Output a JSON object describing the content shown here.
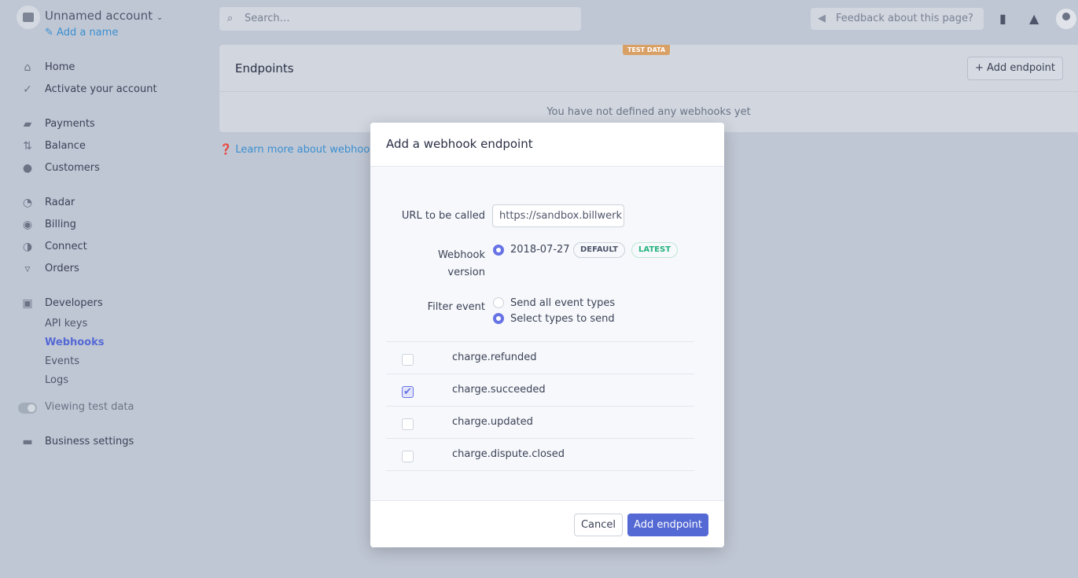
{
  "account": {
    "name": "Unnamed account",
    "add_name": "Add a name"
  },
  "nav": {
    "home": "Home",
    "activate": "Activate your account",
    "payments": "Payments",
    "balance": "Balance",
    "customers": "Customers",
    "radar": "Radar",
    "billing": "Billing",
    "connect": "Connect",
    "orders": "Orders",
    "developers": "Developers",
    "api_keys": "API keys",
    "webhooks": "Webhooks",
    "events": "Events",
    "logs": "Logs",
    "viewing_test": "Viewing test data",
    "business": "Business settings"
  },
  "topbar": {
    "search_placeholder": "Search…",
    "feedback": "Feedback about this page?"
  },
  "panel": {
    "title": "Endpoints",
    "badge": "TEST DATA",
    "add_button": "Add endpoint",
    "empty": "You have not defined any webhooks yet",
    "learn_more": "Learn more about webhooks"
  },
  "modal": {
    "title": "Add a webhook endpoint",
    "url_label": "URL to be called",
    "url_value": "https://sandbox.billwerk",
    "version_label": "Webhook version",
    "version_value": "2018-07-27",
    "default_pill": "DEFAULT",
    "latest_pill": "LATEST",
    "filter_label": "Filter event",
    "filter_all": "Send all event types",
    "filter_select": "Select types to send",
    "filter_selected": "select",
    "events": [
      {
        "name": "charge.refunded",
        "checked": false
      },
      {
        "name": "charge.succeeded",
        "checked": true
      },
      {
        "name": "charge.updated",
        "checked": false
      },
      {
        "name": "charge.dispute.closed",
        "checked": false
      }
    ],
    "cancel": "Cancel",
    "submit": "Add endpoint"
  },
  "colors": {
    "accent": "#5469d4",
    "link": "#3a8fd0",
    "test_badge": "#d9a066",
    "latest": "#24b47e"
  }
}
